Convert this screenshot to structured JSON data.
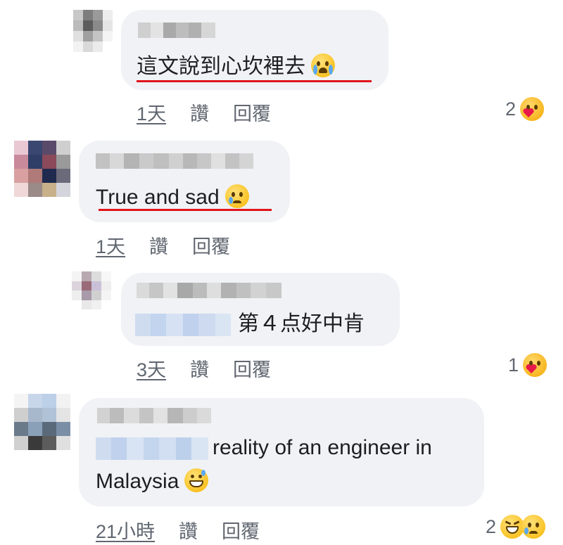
{
  "comments": [
    {
      "text": "這文說到心坎裡去",
      "emoji": "loudly-crying-face",
      "actions": {
        "time": "1天",
        "like": "讚",
        "reply": "回覆"
      },
      "reaction_count": "2",
      "reaction_emoji": "care-emoji"
    },
    {
      "text": "True and sad",
      "emoji": "crying-face",
      "actions": {
        "time": "1天",
        "like": "讚",
        "reply": "回覆"
      }
    },
    {
      "text": "第４点好中肯",
      "actions": {
        "time": "3天",
        "like": "讚",
        "reply": "回覆"
      },
      "reaction_count": "1",
      "reaction_emoji": "care-emoji"
    },
    {
      "text_line1": "reality of an engineer in",
      "text_line2": "Malaysia",
      "emoji": "grinning-face-with-sweat",
      "actions": {
        "time": "21小時",
        "like": "讚",
        "reply": "回覆"
      },
      "reaction_count": "2",
      "reaction_emojis": [
        "laughing-emoji",
        "sad-emoji"
      ]
    }
  ],
  "colors": {
    "bubble": "#f0f2f5",
    "underline": "#e0141c",
    "meta_text": "#606770",
    "blur_gray": "#bdbdbd",
    "blur_blue": "#c9daf0"
  }
}
